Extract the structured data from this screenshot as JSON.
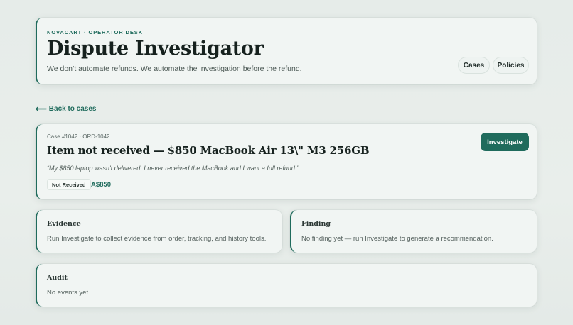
{
  "header": {
    "eyebrow": "NOVACART · OPERATOR DESK",
    "title": "Dispute Investigator",
    "tagline": "We don’t automate refunds. We automate the investigation before the refund.",
    "nav": {
      "cases_label": "Cases",
      "policies_label": "Policies"
    }
  },
  "back_link": {
    "arrow": "⟵",
    "label": "Back to cases"
  },
  "case": {
    "id_line": "Case #1042 · ORD-1042",
    "title": "Item not received — $850 MacBook Air 13\\\" M3 256GB",
    "quote": "“My $850 laptop wasn't delivered. I never received the MacBook and I want a full refund.”",
    "status_badge": "Not Received",
    "amount": "A$850",
    "investigate_label": "Investigate"
  },
  "evidence": {
    "title": "Evidence",
    "body": "Run Investigate to collect evidence from order, tracking, and history tools."
  },
  "finding": {
    "title": "Finding",
    "body": "No finding yet — run Investigate to generate a recommendation."
  },
  "audit": {
    "title": "Audit",
    "body": "No events yet."
  },
  "colors": {
    "accent": "#1f6b5c",
    "background": "#e7ece9",
    "card": "#f1f5f3"
  }
}
